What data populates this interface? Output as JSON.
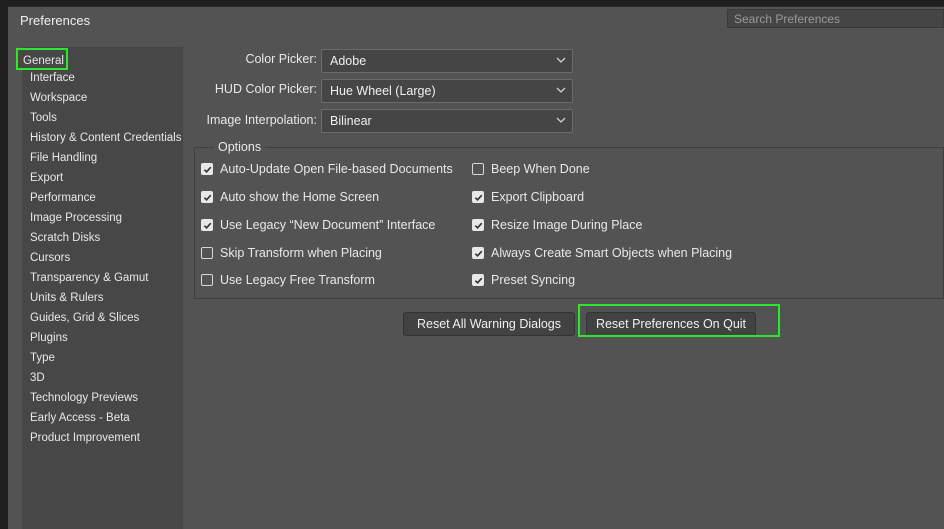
{
  "window": {
    "title": "Preferences"
  },
  "search": {
    "placeholder": "Search Preferences"
  },
  "sidebar": {
    "items": [
      {
        "label": "General",
        "selected": true
      },
      {
        "label": "Interface"
      },
      {
        "label": "Workspace"
      },
      {
        "label": "Tools"
      },
      {
        "label": "History & Content Credentials"
      },
      {
        "label": "File Handling"
      },
      {
        "label": "Export"
      },
      {
        "label": "Performance"
      },
      {
        "label": "Image Processing"
      },
      {
        "label": "Scratch Disks"
      },
      {
        "label": "Cursors"
      },
      {
        "label": "Transparency & Gamut"
      },
      {
        "label": "Units & Rulers"
      },
      {
        "label": "Guides, Grid & Slices"
      },
      {
        "label": "Plugins"
      },
      {
        "label": "Type"
      },
      {
        "label": "3D"
      },
      {
        "label": "Technology Previews"
      },
      {
        "label": "Early Access - Beta"
      },
      {
        "label": "Product Improvement"
      }
    ]
  },
  "fields": {
    "color_picker": {
      "label": "Color Picker:",
      "value": "Adobe"
    },
    "hud_color_picker": {
      "label": "HUD Color Picker:",
      "value": "Hue Wheel (Large)"
    },
    "image_interpolation": {
      "label": "Image Interpolation:",
      "value": "Bilinear"
    }
  },
  "options": {
    "legend": "Options",
    "left": [
      {
        "label": "Auto-Update Open File-based Documents",
        "checked": true
      },
      {
        "label": "Auto show the Home Screen",
        "checked": true
      },
      {
        "label": "Use Legacy “New Document” Interface",
        "checked": true
      },
      {
        "label": "Skip Transform when Placing",
        "checked": false
      },
      {
        "label": "Use Legacy Free Transform",
        "checked": false
      }
    ],
    "right": [
      {
        "label": "Beep When Done",
        "checked": false
      },
      {
        "label": "Export Clipboard",
        "checked": true
      },
      {
        "label": "Resize Image During Place",
        "checked": true
      },
      {
        "label": "Always Create Smart Objects when Placing",
        "checked": true
      },
      {
        "label": "Preset Syncing",
        "checked": true
      }
    ]
  },
  "buttons": {
    "reset_warnings": "Reset All Warning Dialogs",
    "reset_prefs": "Reset Preferences On Quit"
  },
  "colors": {
    "highlight": "#2ee62e",
    "panel": "#535353",
    "sidebar": "#474747"
  },
  "icons": {
    "dropdown": "chevron-down-icon",
    "checkbox_checked": "checkmark-icon"
  }
}
